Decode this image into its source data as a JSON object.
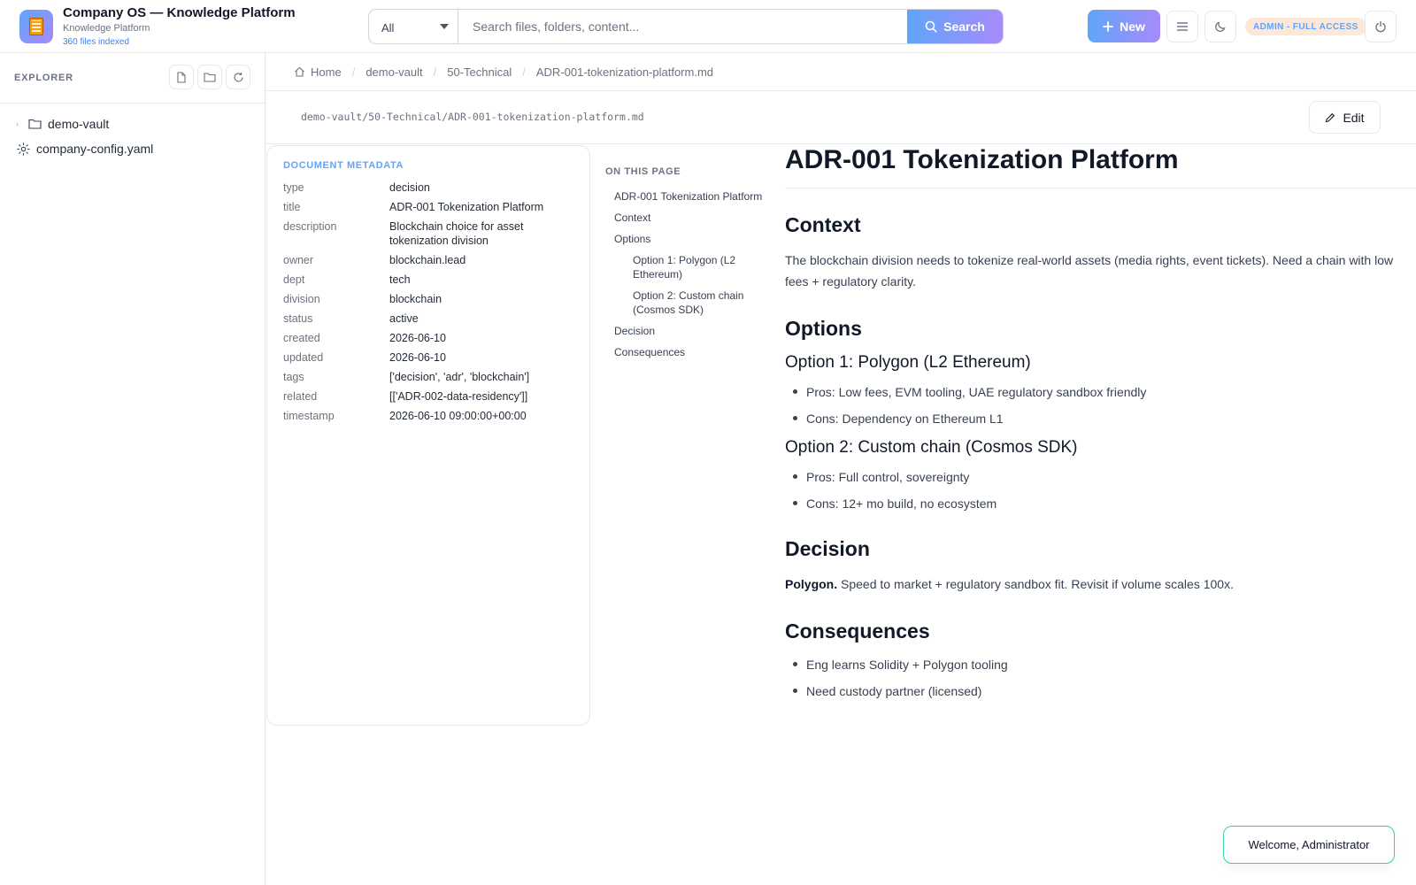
{
  "header": {
    "app_title": "Company OS — Knowledge Platform",
    "app_subtitle": "Knowledge Platform",
    "files_indexed": "360 files indexed",
    "search": {
      "scope": "All",
      "placeholder": "Search files, folders, content...",
      "button_label": "Search"
    },
    "new_button_label": "New",
    "admin_badge": "ADMIN - FULL ACCESS",
    "icons": [
      "search-icon",
      "plus-icon",
      "menu-icon",
      "moon-icon",
      "power-icon"
    ]
  },
  "sidebar": {
    "title": "EXPLORER",
    "tools": [
      "new-file-icon",
      "new-folder-icon",
      "refresh-icon"
    ],
    "items": [
      {
        "label": "demo-vault",
        "icon": "folder-icon"
      },
      {
        "label": "company-config.yaml",
        "icon": "gear-icon"
      }
    ]
  },
  "breadcrumb": [
    "Home",
    "demo-vault",
    "50-Technical",
    "ADR-001-tokenization-platform.md"
  ],
  "file_path": "demo-vault/50-Technical/ADR-001-tokenization-platform.md",
  "edit_label": "Edit",
  "metadata": {
    "title": "DOCUMENT METADATA",
    "rows": [
      {
        "key": "type",
        "value": "decision"
      },
      {
        "key": "title",
        "value": "ADR-001 Tokenization Platform"
      },
      {
        "key": "description",
        "value": "Blockchain choice for asset tokenization division"
      },
      {
        "key": "owner",
        "value": "blockchain.lead"
      },
      {
        "key": "dept",
        "value": "tech"
      },
      {
        "key": "division",
        "value": "blockchain"
      },
      {
        "key": "status",
        "value": "active"
      },
      {
        "key": "created",
        "value": "2026-06-10"
      },
      {
        "key": "updated",
        "value": "2026-06-10"
      },
      {
        "key": "tags",
        "value": "['decision', 'adr', 'blockchain']"
      },
      {
        "key": "related",
        "value": "[['ADR-002-data-residency']]"
      },
      {
        "key": "timestamp",
        "value": "2026-06-10 09:00:00+00:00"
      }
    ]
  },
  "toc": {
    "title": "ON THIS PAGE",
    "items": [
      "ADR-001 Tokenization Platform",
      "Context",
      "Options",
      "Option 1: Polygon (L2 Ethereum)",
      "Option 2: Custom chain (Cosmos SDK)",
      "Decision",
      "Consequences"
    ]
  },
  "document": {
    "title": "ADR-001 Tokenization Platform",
    "context_heading": "Context",
    "context_text": "The blockchain division needs to tokenize real-world assets (media rights, event tickets). Need a chain with low fees + regulatory clarity.",
    "options_heading": "Options",
    "option1_heading": "Option 1: Polygon (L2 Ethereum)",
    "option1_items": [
      "Pros: Low fees, EVM tooling, UAE regulatory sandbox friendly",
      "Cons: Dependency on Ethereum L1"
    ],
    "option2_heading": "Option 2: Custom chain (Cosmos SDK)",
    "option2_items": [
      "Pros: Full control, sovereignty",
      "Cons: 12+ mo build, no ecosystem"
    ],
    "decision_heading": "Decision",
    "decision_bold": "Polygon.",
    "decision_text": " Speed to market + regulatory sandbox fit. Revisit if volume scales 100x.",
    "consequences_heading": "Consequences",
    "consequences_items": [
      "Eng learns Solidity + Polygon tooling",
      "Need custody partner (licensed)"
    ]
  },
  "toast": "Welcome, Administrator"
}
